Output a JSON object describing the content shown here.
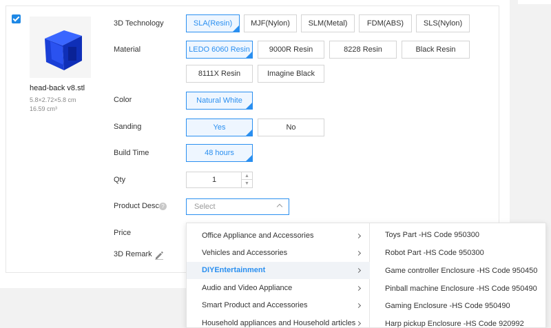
{
  "item": {
    "file_name": "head-back v8.stl",
    "dimensions": "5.8×2.72×5.8 cm",
    "volume": "16.59 cm³"
  },
  "labels": {
    "technology": "3D Technology",
    "material": "Material",
    "color": "Color",
    "sanding": "Sanding",
    "build_time": "Build Time",
    "qty": "Qty",
    "product_desc": "Product Desc",
    "price": "Price",
    "remark": "3D Remark"
  },
  "technology": [
    "SLA(Resin)",
    "MJF(Nylon)",
    "SLM(Metal)",
    "FDM(ABS)",
    "SLS(Nylon)"
  ],
  "material": [
    "LEDO 6060 Resin",
    "9000R Resin",
    "8228 Resin",
    "Black Resin",
    "8111X Resin",
    "Imagine Black"
  ],
  "color": [
    "Natural White"
  ],
  "sanding": [
    "Yes",
    "No"
  ],
  "build_time": [
    "48 hours"
  ],
  "qty": {
    "value": "1",
    "up": "▲",
    "down": "▼"
  },
  "product_desc": {
    "placeholder": "Select"
  },
  "help_glyph": "?",
  "dropdown": {
    "categories": [
      "Office Appliance and Accessories",
      "Vehicles and Accessories",
      "DIYEntertainment",
      "Audio and Video Appliance",
      "Smart Product and Accessories",
      "Household appliances and Household articles"
    ],
    "active_category": "DIYEntertainment",
    "subcategories": [
      "Toys Part -HS Code 950300",
      "Robot Part -HS Code 950300",
      "Game controller Enclosure -HS Code 950450",
      "Pinball machine Enclosure -HS Code 950490",
      "Gaming Enclosure -HS Code 950490",
      "Harp pickup Enclosure -HS Code 920992"
    ]
  },
  "colors": {
    "accent": "#2a8ff0",
    "checkbox": "#1e88e5",
    "model_blue": "#1a3fd6",
    "border": "#d4d4d4"
  },
  "icons": {
    "checkbox": "checkmark-icon",
    "help": "question-circle-icon",
    "remark": "pencil-icon",
    "submenu": "chevron-right-icon",
    "select": "chevron-up-icon"
  }
}
